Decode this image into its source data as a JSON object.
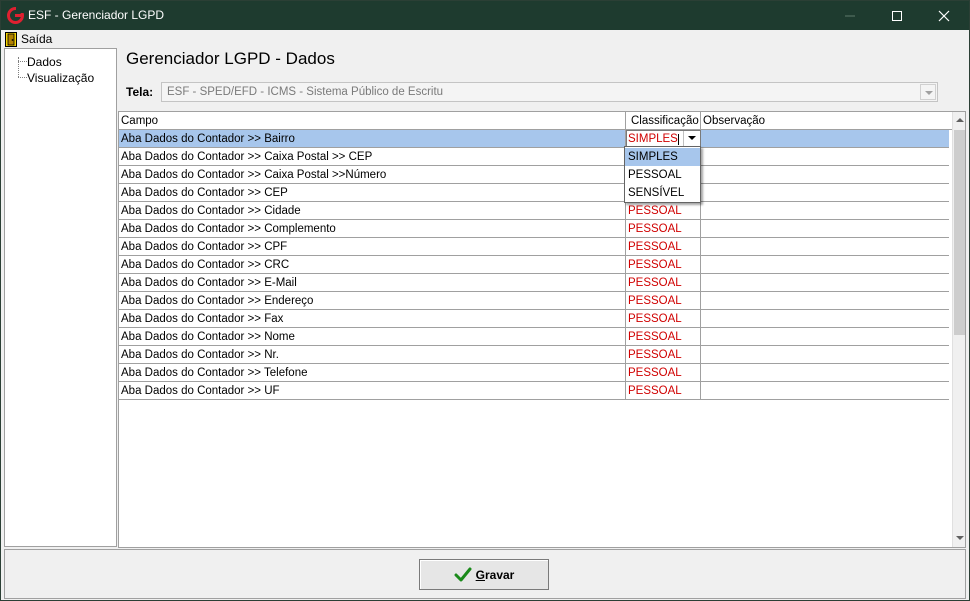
{
  "window": {
    "title": "ESF - Gerenciador LGPD"
  },
  "menu": {
    "exit_label": "Saída"
  },
  "tree": {
    "items": [
      {
        "label": "Dados"
      },
      {
        "label": "Visualização"
      }
    ]
  },
  "page": {
    "title": "Gerenciador LGPD - Dados",
    "tela_label": "Tela:",
    "tela_value": "ESF - SPED/EFD - ICMS - Sistema Público de Escritu"
  },
  "grid": {
    "columns": {
      "campo": "Campo",
      "classificacao": "Classificação",
      "observacao": "Observação"
    },
    "rows": [
      {
        "campo": "Aba Dados do Contador >> Bairro",
        "classificacao": "SIMPLES",
        "observacao": "",
        "selected": true
      },
      {
        "campo": "Aba Dados do Contador >> Caixa Postal >> CEP",
        "classificacao": "",
        "observacao": ""
      },
      {
        "campo": "Aba Dados do Contador >> Caixa Postal >>Número",
        "classificacao": "",
        "observacao": ""
      },
      {
        "campo": "Aba Dados do Contador >> CEP",
        "classificacao": "",
        "observacao": ""
      },
      {
        "campo": "Aba Dados do Contador >> Cidade",
        "classificacao": "PESSOAL",
        "observacao": ""
      },
      {
        "campo": "Aba Dados do Contador >> Complemento",
        "classificacao": "PESSOAL",
        "observacao": ""
      },
      {
        "campo": "Aba Dados do Contador >> CPF",
        "classificacao": "PESSOAL",
        "observacao": ""
      },
      {
        "campo": "Aba Dados do Contador >> CRC",
        "classificacao": "PESSOAL",
        "observacao": ""
      },
      {
        "campo": "Aba Dados do Contador >> E-Mail",
        "classificacao": "PESSOAL",
        "observacao": ""
      },
      {
        "campo": "Aba Dados do Contador >> Endereço",
        "classificacao": "PESSOAL",
        "observacao": ""
      },
      {
        "campo": "Aba Dados do Contador >> Fax",
        "classificacao": "PESSOAL",
        "observacao": ""
      },
      {
        "campo": "Aba Dados do Contador >> Nome",
        "classificacao": "PESSOAL",
        "observacao": ""
      },
      {
        "campo": "Aba Dados do Contador >> Nr.",
        "classificacao": "PESSOAL",
        "observacao": ""
      },
      {
        "campo": "Aba Dados do Contador >> Telefone",
        "classificacao": "PESSOAL",
        "observacao": ""
      },
      {
        "campo": "Aba Dados do Contador >> UF",
        "classificacao": "PESSOAL",
        "observacao": ""
      }
    ],
    "dropdown_options": [
      "SIMPLES",
      "PESSOAL",
      "SENSÍVEL"
    ]
  },
  "footer": {
    "save_label_prefix": "G",
    "save_label_rest": "ravar"
  },
  "colors": {
    "titlebar": "#1e3b2f",
    "selection": "#a7c6ec",
    "classification_text": "#d00000"
  }
}
